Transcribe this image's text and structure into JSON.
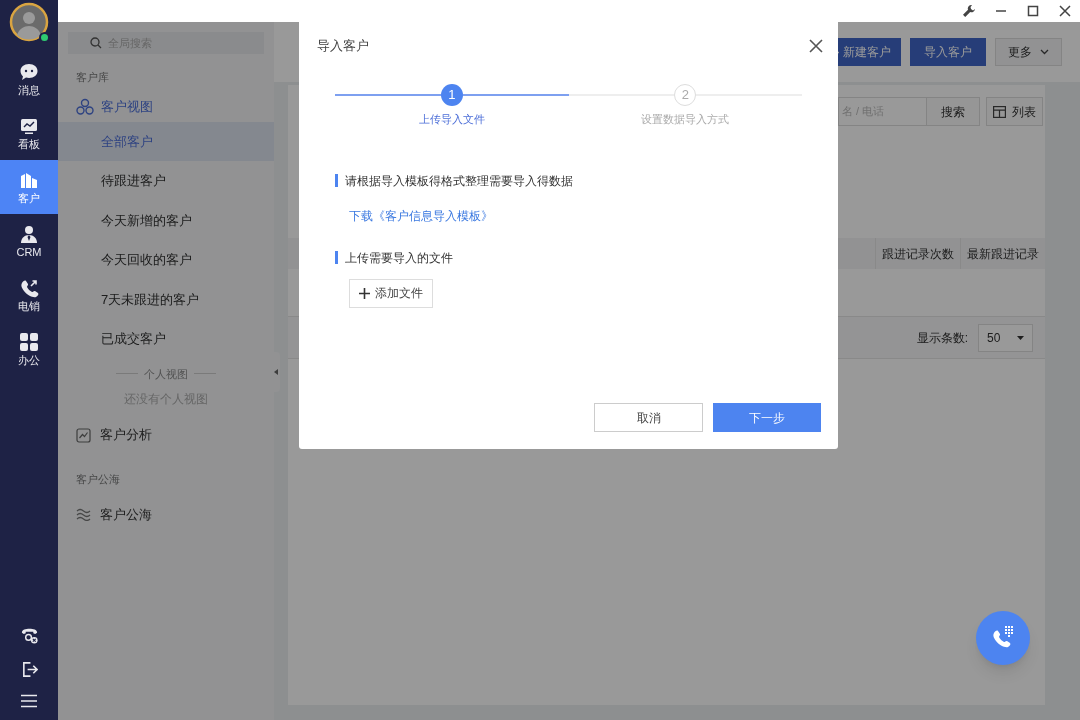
{
  "nav": {
    "items": [
      {
        "label": "消息",
        "selected": false
      },
      {
        "label": "看板",
        "selected": false
      },
      {
        "label": "客户",
        "selected": true
      },
      {
        "label": "CRM",
        "selected": false
      },
      {
        "label": "电销",
        "selected": false
      },
      {
        "label": "办公",
        "selected": false
      }
    ]
  },
  "sidebar": {
    "search_placeholder": "全局搜索",
    "library_label": "客户库",
    "view_group": {
      "label": "客户视图",
      "children": [
        {
          "label": "全部客户",
          "selected": true
        },
        {
          "label": "待跟进客户",
          "selected": false
        },
        {
          "label": "今天新增的客户",
          "selected": false
        },
        {
          "label": "今天回收的客户",
          "selected": false
        },
        {
          "label": "7天未跟进的客户",
          "selected": false
        },
        {
          "label": "已成交客户",
          "selected": false
        }
      ]
    },
    "personal_label": "个人视图",
    "personal_empty": "还没有个人视图",
    "analysis": "客户分析",
    "pool_label": "客户公海",
    "pool": "客户公海"
  },
  "main": {
    "buttons": [
      {
        "label": "新建客户",
        "kind": "primary-plus"
      },
      {
        "label": "导入客户",
        "kind": "primary"
      },
      {
        "label": "更多",
        "kind": "dropdown"
      }
    ],
    "search": {
      "placeholder": "名 / 电话",
      "button": "搜索"
    },
    "view_button": "列表",
    "table": {
      "columns": [
        "跟进记录次数",
        "最新跟进记录"
      ]
    },
    "page_size": {
      "label": "显示条数:",
      "value": "50"
    }
  },
  "dialog": {
    "title": "导入客户",
    "steps": [
      {
        "number": "1",
        "label": "上传导入文件",
        "selected": true
      },
      {
        "number": "2",
        "label": "设置数据导入方式",
        "selected": false
      }
    ],
    "template_heading": "请根据导入模板得格式整理需要导入得数据",
    "template_link": "下载《客户信息导入模板》",
    "upload_heading": "上传需要导入的文件",
    "add_file": "添加文件",
    "cancel": "取消",
    "next": "下一步"
  }
}
